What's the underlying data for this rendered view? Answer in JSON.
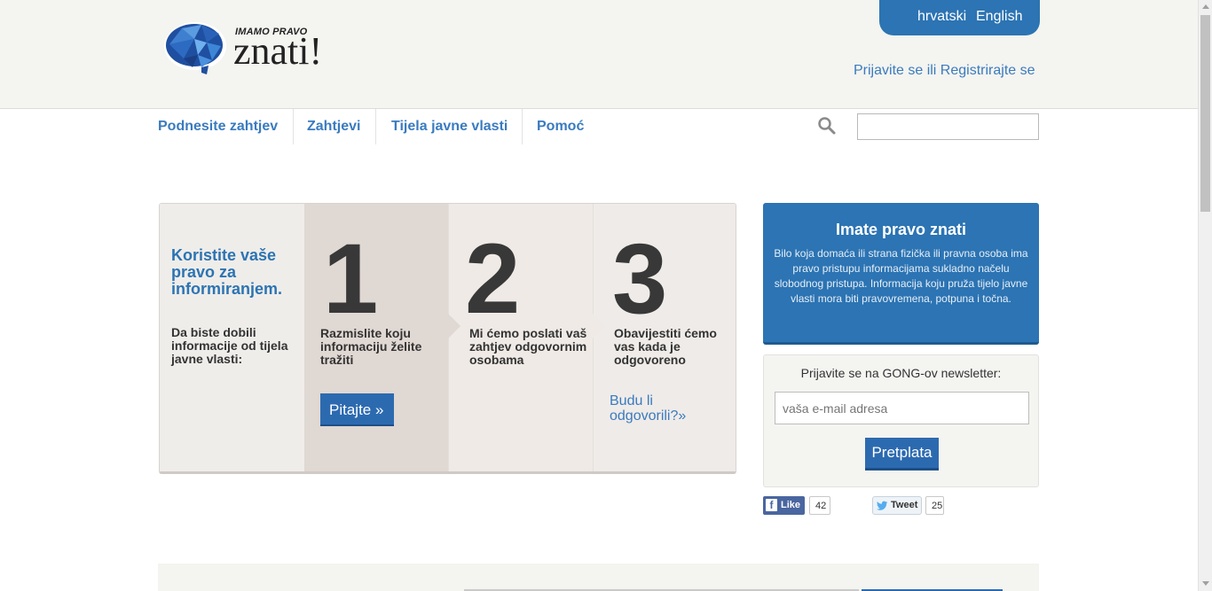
{
  "header": {
    "logo": {
      "small_text": "Imamo pravo",
      "big_text": "znati!",
      "icon": "brain-logo-icon"
    },
    "languages": [
      "hrvatski",
      "English"
    ],
    "auth_link": "Prijavite se ili Registrirajte se"
  },
  "nav": {
    "items": [
      "Podnesite zahtjev",
      "Zahtjevi",
      "Tijela javne vlasti",
      "Pomoć"
    ],
    "search": {
      "icon": "search-icon",
      "placeholder": "",
      "value": ""
    }
  },
  "steps": {
    "intro_title": "Koristite vaše pravo za informiranjem.",
    "intro_text": "Da biste dobili informacije od tijela javne vlasti:",
    "items": [
      {
        "number": "1",
        "text": "Razmislite koju informaciju želite tražiti"
      },
      {
        "number": "2",
        "text": "Mi ćemo poslati vaš zahtjev odgovornim osobama"
      },
      {
        "number": "3",
        "text": "Obavijestiti ćemo vas kada je odgovoreno"
      }
    ],
    "ask_button": "Pitajte »",
    "answered_link": "Budu li odgovorili?»"
  },
  "info": {
    "title": "Imate pravo znati",
    "text": "Bilo koja domaća ili strana fizička ili pravna osoba ima pravo pristupu informacijama sukladno načelu slobodnog pristupa. Informacija koju pruža tijelo javne vlasti mora biti pravovremena, potpuna i točna."
  },
  "newsletter": {
    "label": "Prijavite se na GONG-ov newsletter:",
    "placeholder": "vaša e-mail adresa",
    "button": "Pretplata"
  },
  "social": {
    "facebook": {
      "label": "Like",
      "count": "42"
    },
    "twitter": {
      "label": "Tweet",
      "count": "25"
    }
  },
  "colors": {
    "brand_blue": "#2c74b3",
    "link_blue": "#3a7bbf",
    "button_blue": "#2c6ab0"
  }
}
